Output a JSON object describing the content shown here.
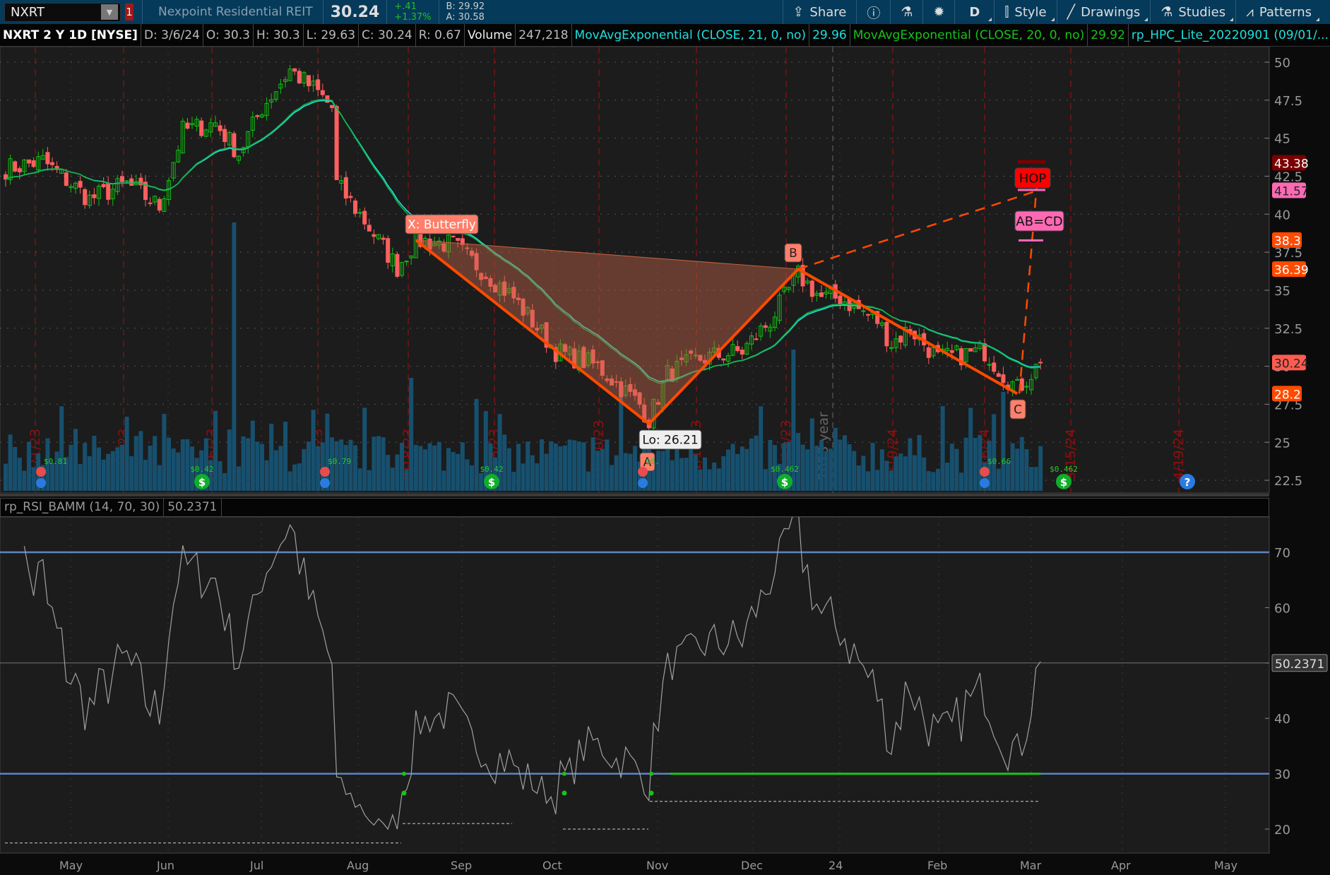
{
  "topbar": {
    "symbol": "NXRT",
    "link_badge": "1",
    "company": "Nexpoint Residential REIT",
    "last": "30.24",
    "change": "+.41",
    "change_pct": "+1.37%",
    "bid": "B: 29.92",
    "ask": "A: 30.58",
    "buttons": {
      "share": "Share",
      "period": "D",
      "style": "Style",
      "drawings": "Drawings",
      "studies": "Studies",
      "patterns": "Patterns"
    }
  },
  "header": {
    "title": "NXRT 2 Y 1D [NYSE]",
    "date": "D: 3/6/24",
    "open": "O: 30.3",
    "high": "H: 30.3",
    "low": "L: 29.63",
    "close": "C: 30.24",
    "range": "R: 0.67",
    "volume_label": "Volume",
    "volume": "247,218",
    "ema21_label": "MovAvgExponential (CLOSE, 21, 0, no)",
    "ema21_value": "29.96",
    "ema20_label": "MovAvgExponential (CLOSE, 20, 0, no)",
    "ema20_value": "29.92",
    "hpc_label": "rp_HPC_Lite_20220901 (09/01/..."
  },
  "price_axis": {
    "ticks": [
      "50",
      "47.5",
      "45",
      "42.5",
      "40",
      "37.5",
      "35",
      "32.5",
      "30",
      "27.5",
      "25",
      "22.5"
    ],
    "markers": [
      {
        "value": "43.38",
        "price": 43.38,
        "color": "#7a0000",
        "text": "#fff"
      },
      {
        "value": "41.57",
        "price": 41.57,
        "color": "#ff69b4",
        "text": "#222"
      },
      {
        "value": "38.3",
        "price": 38.3,
        "color": "#ff4a00",
        "text": "#fff"
      },
      {
        "value": "36.39",
        "price": 36.39,
        "color": "#ff4a00",
        "text": "#fff"
      },
      {
        "value": "30.24",
        "price": 30.24,
        "color": "#ff5c50",
        "text": "#222"
      },
      {
        "value": "28.2",
        "price": 28.2,
        "color": "#ff4a00",
        "text": "#fff"
      }
    ]
  },
  "pattern": {
    "x_label": "X: Butterfly",
    "a_label": "A",
    "b_label": "B",
    "c_label": "C",
    "low_label": "Lo: 26.21",
    "hop_label": "HOP",
    "abcd_label": "AB=CD",
    "points": {
      "X": [
        88,
        38.3
      ],
      "A": [
        138,
        26.21
      ],
      "B": [
        170,
        36.39
      ],
      "C": [
        217,
        28.2
      ]
    }
  },
  "expiration_dates": [
    "4/21/23",
    "5/19/23",
    "6/16/23",
    "7/21/23",
    "8/18/23",
    "9/15/23",
    "10/20/23",
    "11/17/23",
    "12/15/23",
    "1/19/24",
    "2/16/24",
    "3/15/24",
    "4/19/24"
  ],
  "year_marker": "2023 year",
  "events": {
    "dividends": [
      "$0.42",
      "$0.42",
      "$0.462",
      "$0.462"
    ],
    "earnings": [
      "$0.81",
      "$0.79",
      "$0.",
      "$0.66"
    ]
  },
  "rsi": {
    "label": "rp_RSI_BAMM (14, 70, 30)",
    "value": "50.2371",
    "ticks": [
      "70",
      "60",
      "50",
      "40",
      "30",
      "20"
    ],
    "overbought": 70,
    "oversold": 30
  },
  "x_axis": [
    "May",
    "Jun",
    "Jul",
    "Aug",
    "Sep",
    "Oct",
    "Nov",
    "Dec",
    "24",
    "Feb",
    "Mar",
    "Apr",
    "May"
  ],
  "chart_data": {
    "type": "candlestick",
    "bars": 223,
    "ylim": [
      21.5,
      51
    ],
    "price_waypoints": [
      [
        0,
        43
      ],
      [
        8,
        43.5
      ],
      [
        18,
        41
      ],
      [
        26,
        42
      ],
      [
        33,
        40.5
      ],
      [
        38,
        45.5
      ],
      [
        45,
        46
      ],
      [
        50,
        44
      ],
      [
        55,
        47
      ],
      [
        61,
        49.5
      ],
      [
        67,
        48
      ],
      [
        70,
        47
      ],
      [
        71,
        42
      ],
      [
        76,
        40
      ],
      [
        84,
        36.5
      ],
      [
        88,
        38.3
      ],
      [
        96,
        38
      ],
      [
        109,
        34.5
      ],
      [
        118,
        31
      ],
      [
        127,
        30
      ],
      [
        136,
        27.5
      ],
      [
        138,
        26.5
      ],
      [
        142,
        29.5
      ],
      [
        149,
        30.5
      ],
      [
        158,
        31
      ],
      [
        164,
        33
      ],
      [
        170,
        36
      ],
      [
        175,
        34.5
      ],
      [
        179,
        34.5
      ],
      [
        187,
        33
      ],
      [
        190,
        31.5
      ],
      [
        194,
        32.5
      ],
      [
        200,
        30.5
      ],
      [
        210,
        31
      ],
      [
        214,
        29.5
      ],
      [
        217,
        28.5
      ],
      [
        222,
        30.24
      ]
    ],
    "volume_spikes": [
      [
        49,
        380
      ],
      [
        87,
        160
      ],
      [
        101,
        130
      ],
      [
        132,
        145
      ],
      [
        169,
        200
      ],
      [
        201,
        120
      ],
      [
        214,
        140
      ],
      [
        26,
        105
      ],
      [
        57,
        95
      ]
    ]
  }
}
